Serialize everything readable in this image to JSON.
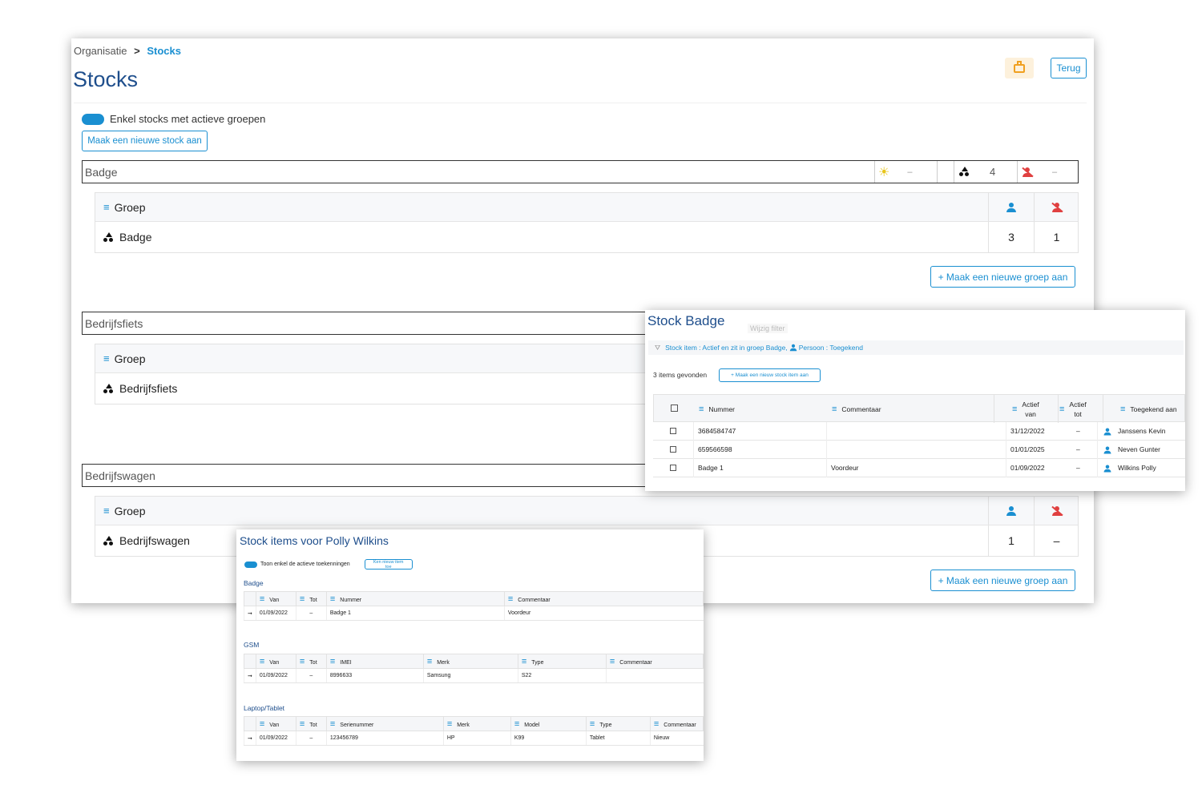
{
  "breadcrumb": {
    "parent": "Organisatie",
    "separator": ">",
    "current": "Stocks"
  },
  "page_title": "Stocks",
  "buttons": {
    "back": "Terug",
    "new_stock": "Maak een nieuwe stock aan",
    "new_group": "+ Maak een nieuwe groep aan"
  },
  "toggle_label": "Enkel stocks met actieve groepen",
  "badge_stock": {
    "name": "Badge",
    "stat_sun": "–",
    "stat_group": "4",
    "stat_unassigned": "–",
    "col_group": "Groep",
    "row_name": "Badge",
    "row_assigned": "3",
    "row_unassigned": "1"
  },
  "bedrijfsfiets": {
    "name": "Bedrijfsfiets",
    "col_group": "Groep",
    "row_name": "Bedrijfsfiets"
  },
  "bedrijfswagen": {
    "name": "Bedrijfswagen",
    "col_group": "Groep",
    "row_name": "Bedrijfswagen",
    "row_assigned": "1",
    "row_unassigned": "–"
  },
  "stock_badge": {
    "title": "Stock Badge",
    "tooltip": "Wijzig filter",
    "filter": "Stock item : Actief en zit in groep Badge,",
    "filter2": "Persoon : Toegekend",
    "count": "3 items gevonden",
    "new_item": "+ Maak een nieuw stock item aan",
    "headers": {
      "nummer": "Nummer",
      "commentaar": "Commentaar",
      "actief_van_1": "Actief",
      "actief_van_2": "van",
      "actief_tot_1": "Actief",
      "actief_tot_2": "tot",
      "toegekend": "Toegekend aan"
    },
    "rows": [
      {
        "nummer": "3684584747",
        "commentaar": "",
        "van": "31/12/2022",
        "tot": "–",
        "persoon": "Janssens Kevin"
      },
      {
        "nummer": "659566598",
        "commentaar": "",
        "van": "01/01/2025",
        "tot": "–",
        "persoon": "Neven Gunter"
      },
      {
        "nummer": "Badge 1",
        "commentaar": "Voordeur",
        "van": "01/09/2022",
        "tot": "–",
        "persoon": "Wilkins Polly"
      }
    ]
  },
  "polly": {
    "title": "Stock items voor Polly Wilkins",
    "toggle": "Toon enkel de actieve toekenningen",
    "new_item": "Ken nieuw item toe",
    "badge": {
      "section": "Badge",
      "h": [
        "Van",
        "Tot",
        "Nummer",
        "Commentaar"
      ],
      "row": [
        "01/09/2022",
        "–",
        "Badge 1",
        "Voordeur"
      ]
    },
    "gsm": {
      "section": "GSM",
      "h": [
        "Van",
        "Tot",
        "IMEI",
        "Merk",
        "Type",
        "Commentaar"
      ],
      "row": [
        "01/09/2022",
        "–",
        "8996633",
        "Samsung",
        "S22",
        ""
      ]
    },
    "laptop": {
      "section": "Laptop/Tablet",
      "h": [
        "Van",
        "Tot",
        "Serienummer",
        "Merk",
        "Model",
        "Type",
        "Commentaar"
      ],
      "row": [
        "01/09/2022",
        "–",
        "123456789",
        "HP",
        "K99",
        "Tablet",
        "Nieuw"
      ]
    }
  }
}
